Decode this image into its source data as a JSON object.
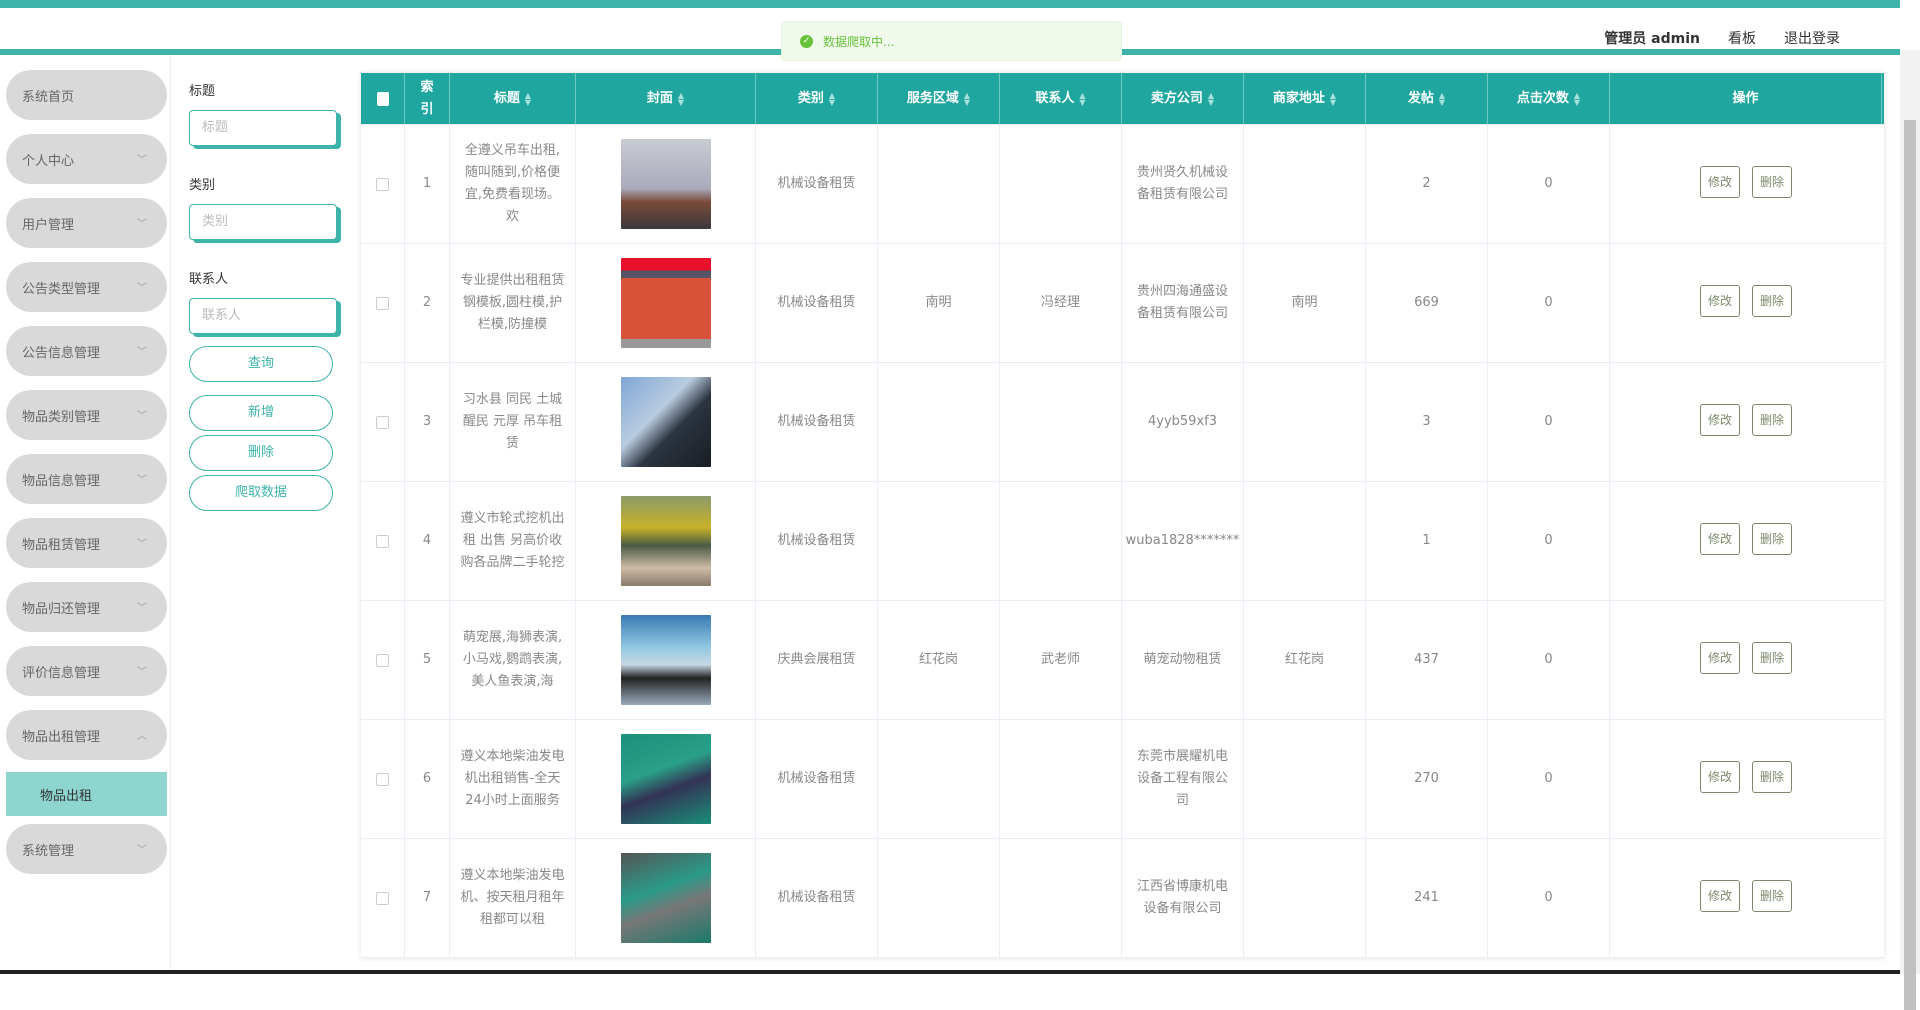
{
  "header": {
    "user": "管理员 admin",
    "board": "看板",
    "logout": "退出登录"
  },
  "toast": {
    "text": "数据爬取中..."
  },
  "sidebar": {
    "items": [
      {
        "label": "系统首页",
        "chevron": false
      },
      {
        "label": "个人中心",
        "chevron": true
      },
      {
        "label": "用户管理",
        "chevron": true
      },
      {
        "label": "公告类型管理",
        "chevron": true
      },
      {
        "label": "公告信息管理",
        "chevron": true
      },
      {
        "label": "物品类别管理",
        "chevron": true
      },
      {
        "label": "物品信息管理",
        "chevron": true
      },
      {
        "label": "物品租赁管理",
        "chevron": true
      },
      {
        "label": "物品归还管理",
        "chevron": true
      },
      {
        "label": "评价信息管理",
        "chevron": true
      },
      {
        "label": "物品出租管理",
        "chevron": true,
        "expanded": true
      },
      {
        "label": "系统管理",
        "chevron": true
      }
    ],
    "subitem": "物品出租"
  },
  "filter": {
    "title_label": "标题",
    "title_placeholder": "标题",
    "category_label": "类别",
    "category_placeholder": "类别",
    "contact_label": "联系人",
    "contact_placeholder": "联系人",
    "buttons": {
      "search": "查询",
      "add": "新增",
      "delete": "删除",
      "crawl": "爬取数据"
    }
  },
  "table": {
    "columns": [
      "索引",
      "标题",
      "封面",
      "类别",
      "服务区域",
      "联系人",
      "卖方公司",
      "商家地址",
      "发帖",
      "点击次数",
      "操作"
    ],
    "edit_label": "修改",
    "delete_label": "删除",
    "rows": [
      {
        "index": "1",
        "title": "全遵义吊车出租,随叫随到,价格便宜,免费看现场。欢",
        "category": "机械设备租赁",
        "area": "",
        "contact": "",
        "company": "贵州贤久机械设备租赁有限公司",
        "address": "",
        "posts": "2",
        "clicks": "0",
        "cover": "crane-photo"
      },
      {
        "index": "2",
        "title": "专业提供出租租赁钢模板,圆柱模,护栏模,防撞模",
        "category": "机械设备租赁",
        "area": "南明",
        "contact": "冯经理",
        "company": "贵州四海通盛设备租赁有限公司",
        "address": "南明",
        "posts": "669",
        "clicks": "0",
        "cover": "steel-formwork-photo"
      },
      {
        "index": "3",
        "title": "习水县 同民 土城 醒民 元厚 吊车租赁",
        "category": "机械设备租赁",
        "area": "",
        "contact": "",
        "company": "4yyb59xf3",
        "address": "",
        "posts": "3",
        "clicks": "0",
        "cover": "crane-tower-photo"
      },
      {
        "index": "4",
        "title": "遵义市轮式挖机出租 出售 另高价收购各品牌二手轮挖",
        "category": "机械设备租赁",
        "area": "",
        "contact": "",
        "company": "wuba1828*******",
        "address": "",
        "posts": "1",
        "clicks": "0",
        "cover": "excavator-photo"
      },
      {
        "index": "5",
        "title": "萌宠展,海狮表演,小马戏,鹦鹉表演,美人鱼表演,海",
        "category": "庆典会展租赁",
        "area": "红花岗",
        "contact": "武老师",
        "company": "萌宠动物租赁",
        "address": "红花岗",
        "posts": "437",
        "clicks": "0",
        "cover": "sea-lion-photo"
      },
      {
        "index": "6",
        "title": "遵义本地柴油发电机出租销售-全天24小时上面服务",
        "category": "机械设备租赁",
        "area": "",
        "contact": "",
        "company": "东莞市展耀机电设备工程有限公司",
        "address": "",
        "posts": "270",
        "clicks": "0",
        "cover": "generator-photo"
      },
      {
        "index": "7",
        "title": "遵义本地柴油发电机、按天租月租年租都可以租",
        "category": "机械设备租赁",
        "area": "",
        "contact": "",
        "company": "江西省博康机电设备有限公司",
        "address": "",
        "posts": "241",
        "clicks": "0",
        "cover": "generator-warehouse-photo"
      }
    ]
  }
}
